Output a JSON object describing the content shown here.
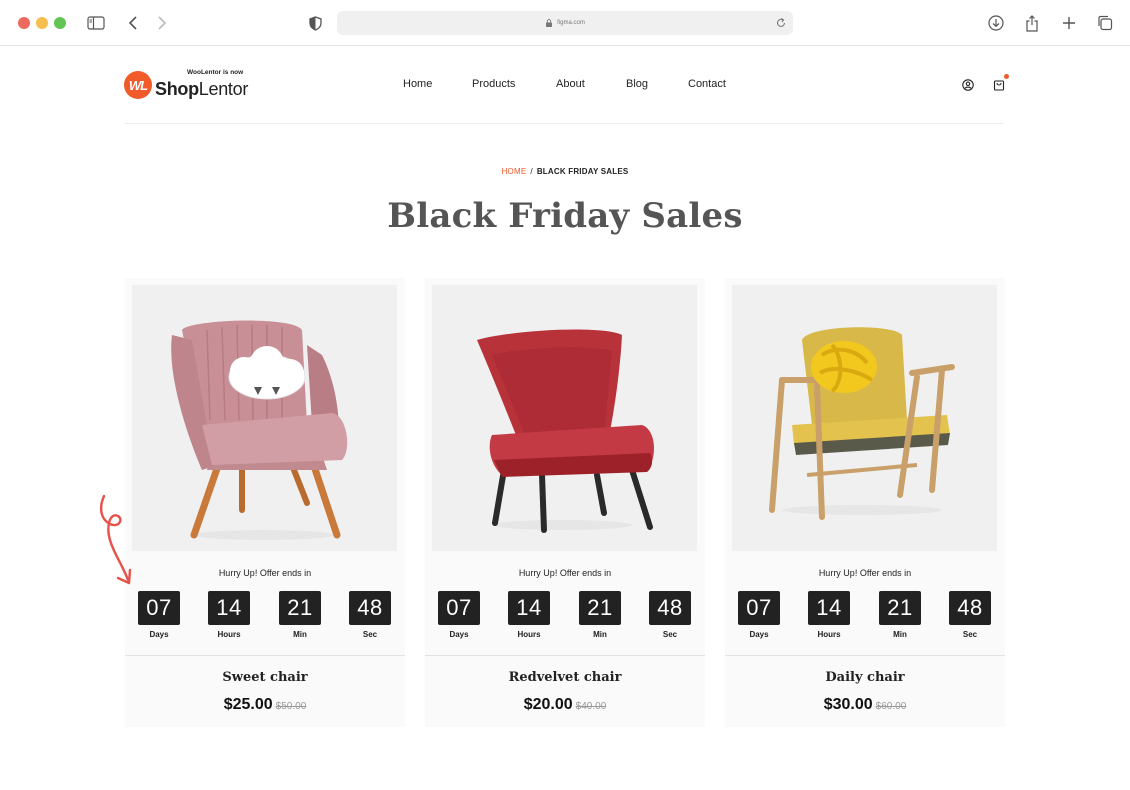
{
  "browser": {
    "url": "figma.com"
  },
  "brand": {
    "tagline": "WooLentor is now",
    "name_bold": "Shop",
    "name_rest": "Lentor",
    "badge": "WL"
  },
  "nav": {
    "items": [
      "Home",
      "Products",
      "About",
      "Blog",
      "Contact"
    ]
  },
  "breadcrumb": {
    "home": "HOME",
    "separator": "/",
    "current": "BLACK FRIDAY SALES"
  },
  "page": {
    "title": "Black Friday Sales"
  },
  "products": [
    {
      "name": "Sweet chair",
      "price": "$25.00",
      "old_price": "$50.00",
      "hurry_text": "Hurry Up! Offer ends in",
      "countdown": {
        "days": "07",
        "hours": "14",
        "min": "21",
        "sec": "48"
      },
      "color": "#c98f97"
    },
    {
      "name": "Redvelvet chair",
      "price": "$20.00",
      "old_price": "$40.00",
      "hurry_text": "Hurry Up! Offer ends in",
      "countdown": {
        "days": "07",
        "hours": "14",
        "min": "21",
        "sec": "48"
      },
      "color": "#b8323a"
    },
    {
      "name": "Daily chair",
      "price": "$30.00",
      "old_price": "$60.00",
      "hurry_text": "Hurry Up! Offer ends in",
      "countdown": {
        "days": "07",
        "hours": "14",
        "min": "21",
        "sec": "48"
      },
      "color": "#d9b84a"
    }
  ],
  "countdown_labels": {
    "days": "Days",
    "hours": "Hours",
    "min": "Min",
    "sec": "Sec"
  },
  "colors": {
    "accent": "#f15a29",
    "countdown_bg": "#222222"
  }
}
